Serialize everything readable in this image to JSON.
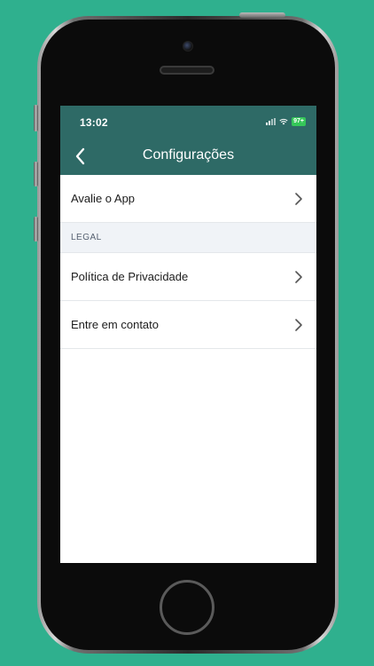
{
  "status_bar": {
    "time": "13:02",
    "battery": "97+"
  },
  "nav": {
    "title": "Configurações"
  },
  "rows": {
    "rate_app": "Avalie o App",
    "privacy_policy": "Política de Privacidade",
    "contact": "Entre em contato"
  },
  "sections": {
    "legal": "LEGAL"
  },
  "icons": {
    "back": "chevron-left-icon",
    "row_disclosure": "chevron-right-icon",
    "signal": "cellular-signal-icon",
    "wifi": "wifi-icon",
    "battery": "battery-icon"
  },
  "colors": {
    "background": "#2fb08e",
    "header": "#2e6a66",
    "battery": "#35c759",
    "section_bg": "#f0f3f7"
  }
}
